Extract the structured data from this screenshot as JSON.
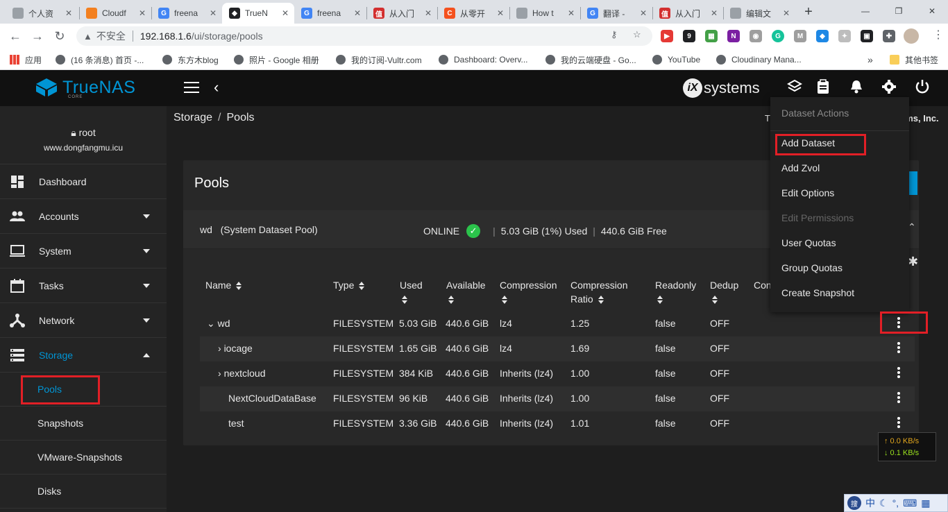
{
  "browser": {
    "tabs": [
      {
        "title": "个人资",
        "color": "#9aa0a6",
        "glyph": ""
      },
      {
        "title": "Cloudf",
        "color": "#f38020",
        "glyph": ""
      },
      {
        "title": "freena",
        "color": "#4285f4",
        "glyph": "G"
      },
      {
        "title": "TrueN",
        "color": "#202124",
        "glyph": "◆",
        "active": true
      },
      {
        "title": "freena",
        "color": "#4285f4",
        "glyph": "G"
      },
      {
        "title": "从入门",
        "color": "#d32f2f",
        "glyph": "值"
      },
      {
        "title": "从零开",
        "color": "#f4511e",
        "glyph": "C"
      },
      {
        "title": "How t",
        "color": "#9aa0a6",
        "glyph": ""
      },
      {
        "title": "翻译 -",
        "color": "#4285f4",
        "glyph": "G"
      },
      {
        "title": "从入门",
        "color": "#d32f2f",
        "glyph": "值"
      },
      {
        "title": "编辑文",
        "color": "#9aa0a6",
        "glyph": ""
      }
    ],
    "address": {
      "insecure_label": "不安全",
      "host": "192.168.1.6",
      "path": "/ui/storage/pools"
    },
    "bookmarks": [
      {
        "label": "应用"
      },
      {
        "label": "(16 条消息) 首页 -..."
      },
      {
        "label": "东方木blog"
      },
      {
        "label": "照片 - Google 相册"
      },
      {
        "label": "我的订阅-Vultr.com"
      },
      {
        "label": "Dashboard: Overv..."
      },
      {
        "label": "我的云端硬盘 - Go..."
      },
      {
        "label": "YouTube"
      },
      {
        "label": "Cloudinary Mana..."
      }
    ],
    "bookmarks_more": "»",
    "other_bookmarks": "其他书签"
  },
  "app": {
    "logo_text": "TrueNAS",
    "logo_sub": "CORE",
    "vendor": "systems",
    "vendor_mark": "iX"
  },
  "sidebar": {
    "user": "root",
    "hostname": "www.dongfangmu.icu",
    "items": [
      {
        "label": "Dashboard",
        "icon": "dashboard-icon"
      },
      {
        "label": "Accounts",
        "icon": "accounts-icon"
      },
      {
        "label": "System",
        "icon": "system-icon"
      },
      {
        "label": "Tasks",
        "icon": "tasks-icon"
      },
      {
        "label": "Network",
        "icon": "network-icon"
      },
      {
        "label": "Storage",
        "icon": "storage-icon"
      }
    ],
    "storage_sub": [
      "Pools",
      "Snapshots",
      "VMware-Snapshots",
      "Disks"
    ]
  },
  "breadcrumb": {
    "root": "Storage",
    "sep": "/",
    "current": "Pools"
  },
  "header_right": {
    "left": "T",
    "right": "ems, Inc."
  },
  "pools_card": {
    "title": "Pools",
    "pool": {
      "name": "wd",
      "desc": "(System Dataset Pool)",
      "status": "ONLINE",
      "used": "5.03 GiB (1%) Used",
      "free": "440.6 GiB Free"
    }
  },
  "table": {
    "headers": {
      "name": "Name",
      "type": "Type",
      "used": "Used",
      "available": "Available",
      "compression": "Compression",
      "ratio_1": "Compression",
      "ratio_2": "Ratio",
      "readonly": "Readonly",
      "dedup": "Dedup",
      "comments": "Con"
    },
    "rows": [
      {
        "name": "wd",
        "type": "FILESYSTEM",
        "used": "5.03 GiB",
        "available": "440.6 GiB",
        "compression": "lz4",
        "ratio": "1.25",
        "readonly": "false",
        "dedup": "OFF"
      },
      {
        "name": "iocage",
        "type": "FILESYSTEM",
        "used": "1.65 GiB",
        "available": "440.6 GiB",
        "compression": "lz4",
        "ratio": "1.69",
        "readonly": "false",
        "dedup": "OFF"
      },
      {
        "name": "nextcloud",
        "type": "FILESYSTEM",
        "used": "384 KiB",
        "available": "440.6 GiB",
        "compression": "Inherits (lz4)",
        "ratio": "1.00",
        "readonly": "false",
        "dedup": "OFF"
      },
      {
        "name": "NextCloudDataBase",
        "type": "FILESYSTEM",
        "used": "96 KiB",
        "available": "440.6 GiB",
        "compression": "Inherits (lz4)",
        "ratio": "1.00",
        "readonly": "false",
        "dedup": "OFF"
      },
      {
        "name": "test",
        "type": "FILESYSTEM",
        "used": "3.36 GiB",
        "available": "440.6 GiB",
        "compression": "Inherits (lz4)",
        "ratio": "1.01",
        "readonly": "false",
        "dedup": "OFF"
      }
    ]
  },
  "menu": {
    "title": "Dataset Actions",
    "items": [
      {
        "label": "Add Dataset",
        "enabled": true
      },
      {
        "label": "Add Zvol",
        "enabled": true
      },
      {
        "label": "Edit Options",
        "enabled": true
      },
      {
        "label": "Edit Permissions",
        "enabled": false
      },
      {
        "label": "User Quotas",
        "enabled": true
      },
      {
        "label": "Group Quotas",
        "enabled": true
      },
      {
        "label": "Create Snapshot",
        "enabled": true
      }
    ]
  },
  "netspeed": {
    "up": "↑ 0.0 KB/s",
    "down": "↓ 0.1 KB/s"
  },
  "ime": {
    "label": "中",
    "logo": "搜"
  },
  "colors": {
    "accent": "#0095d5",
    "highlight": "#e21f26",
    "online": "#2bc34b"
  }
}
